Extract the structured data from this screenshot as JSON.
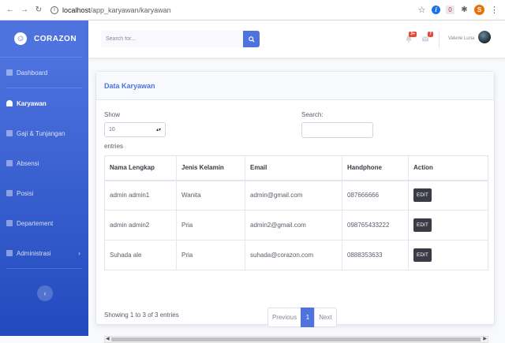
{
  "browser": {
    "url_host": "localhost",
    "url_path": "/app_karyawan/karyawan",
    "profile_initial": "S",
    "extension_badge": "0"
  },
  "sidebar": {
    "brand": "CORAZON",
    "items": [
      {
        "label": "Dashboard",
        "icon": "dashboard-icon",
        "active": false
      },
      {
        "label": "Karyawan",
        "icon": "user-icon",
        "active": true
      },
      {
        "label": "Gaji & Tunjangan",
        "icon": "folder-icon",
        "active": false
      },
      {
        "label": "Absensi",
        "icon": "file-icon",
        "active": false
      },
      {
        "label": "Posisi",
        "icon": "file-icon",
        "active": false
      },
      {
        "label": "Departement",
        "icon": "folder-icon",
        "active": false
      },
      {
        "label": "Administrasi",
        "icon": "cog-icon",
        "active": false
      }
    ],
    "toggle_glyph": "‹"
  },
  "topbar": {
    "search_placeholder": "Search for...",
    "alerts_count": "3+",
    "messages_count": "7",
    "user_name": "Valerie Luna"
  },
  "card": {
    "title": "Data Karyawan",
    "length_label": "Show",
    "length_value": "10",
    "entries_label": "entries",
    "search_label": "Search:",
    "columns": [
      "Nama Lengkap",
      "Jenis Kelamin",
      "Email",
      "Handphone",
      "Action"
    ],
    "rows": [
      {
        "nama": "admin admin1",
        "jk": "Wanita",
        "email": "admin@gmail.com",
        "hp": "087666666",
        "action": "EDIT"
      },
      {
        "nama": "admin admin2",
        "jk": "Pria",
        "email": "admin2@gmail.com",
        "hp": "098765433222",
        "action": "EDIT"
      },
      {
        "nama": "Suhada ale",
        "jk": "Pria",
        "email": "suhada@corazon.com",
        "hp": "0888353633",
        "action": "EDIT"
      }
    ],
    "info": "Showing 1 to 3 of 3 entries",
    "pager": {
      "prev": "Previous",
      "current": "1",
      "next": "Next"
    }
  },
  "colors": {
    "primary": "#4e73df",
    "dark_button": "#3a3b45",
    "danger_badge": "#e74a3b"
  }
}
